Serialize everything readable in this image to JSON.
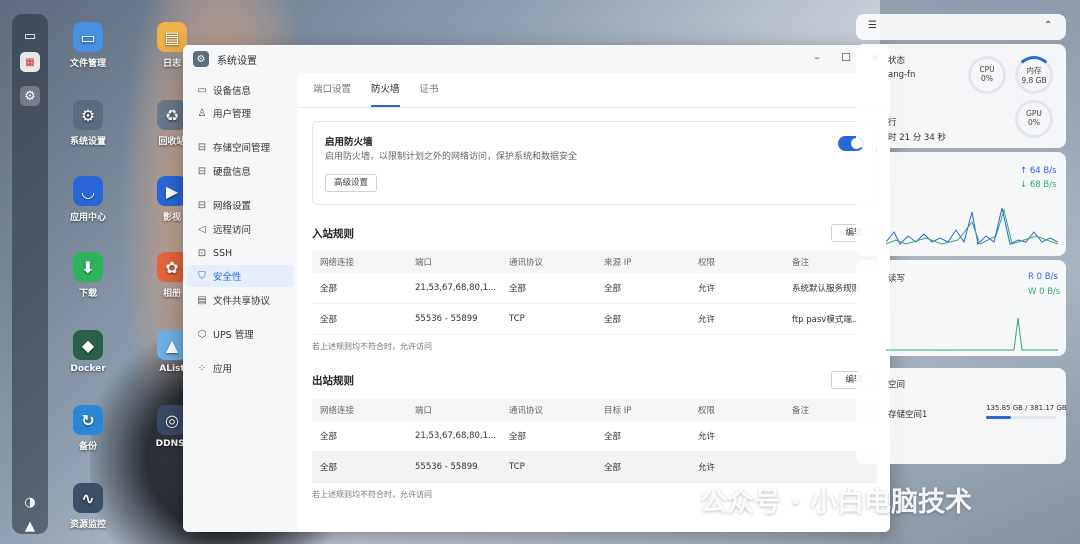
{
  "desktop": {
    "icons": [
      {
        "label": "文件管理",
        "color": "#4a90e2",
        "glyph": "▭"
      },
      {
        "label": "日志",
        "color": "#f0b04a",
        "glyph": "▤"
      },
      {
        "label": "系统设置",
        "color": "#5c6b7d",
        "glyph": "⚙"
      },
      {
        "label": "回收站",
        "color": "#6a7889",
        "glyph": "♻"
      },
      {
        "label": "应用中心",
        "color": "#2b66d9",
        "glyph": "◡"
      },
      {
        "label": "影视",
        "color": "#2b66d9",
        "glyph": "▶"
      },
      {
        "label": "下载",
        "color": "#2fb35a",
        "glyph": "⬇"
      },
      {
        "label": "相册",
        "color": "#e6653c",
        "glyph": "✿"
      },
      {
        "label": "Docker",
        "color": "#2a5f4a",
        "glyph": "◆"
      },
      {
        "label": "AList",
        "color": "#6fb2e8",
        "glyph": "▲"
      },
      {
        "label": "备份",
        "color": "#2b86d9",
        "glyph": "↻"
      },
      {
        "label": "DDNS-",
        "color": "#3a4a66",
        "glyph": "◎"
      },
      {
        "label": "资源监控",
        "color": "#3c4f66",
        "glyph": "∿"
      }
    ]
  },
  "window": {
    "title": "系统设置",
    "controls": {
      "minimize": "–",
      "maximize": "☐",
      "close": "×"
    }
  },
  "sidebar": {
    "items": [
      {
        "label": "设备信息",
        "icon": "▭"
      },
      {
        "label": "用户管理",
        "icon": "♙"
      },
      {
        "label": "存储空间管理",
        "icon": "⊟"
      },
      {
        "label": "硬盘信息",
        "icon": "⊟"
      },
      {
        "label": "网络设置",
        "icon": "⊟"
      },
      {
        "label": "远程访问",
        "icon": "◁"
      },
      {
        "label": "SSH",
        "icon": "⊡"
      },
      {
        "label": "安全性",
        "icon": "⛉"
      },
      {
        "label": "文件共享协议",
        "icon": "▤"
      },
      {
        "label": "UPS 管理",
        "icon": "⬡"
      },
      {
        "label": "应用",
        "icon": "⁘"
      }
    ],
    "active_index": 7
  },
  "tabs": [
    {
      "label": "端口设置"
    },
    {
      "label": "防火墙"
    },
    {
      "label": "证书"
    }
  ],
  "firewall": {
    "title": "启用防火墙",
    "desc": "启用防火墙，以限制计划之外的网络访问，保护系统和数据安全",
    "advanced_button": "高级设置",
    "enabled": true
  },
  "inbound": {
    "title": "入站规则",
    "edit_button": "编辑",
    "headers": [
      "网络连接",
      "端口",
      "通讯协议",
      "来源 IP",
      "权限",
      "备注"
    ],
    "rows": [
      [
        "全部",
        "21,53,67,68,80,1...",
        "全部",
        "全部",
        "允许",
        "系统默认服务规则"
      ],
      [
        "全部",
        "55536 - 55899",
        "TCP",
        "全部",
        "允许",
        "ftp pasv模式端..."
      ]
    ],
    "note": "若上述规则均不符合时，允许访问"
  },
  "outbound": {
    "title": "出站规则",
    "edit_button": "编辑",
    "headers": [
      "网络连接",
      "端口",
      "通讯协议",
      "目标 IP",
      "权限",
      "备注"
    ],
    "rows": [
      [
        "全部",
        "21,53,67,68,80,1...",
        "全部",
        "全部",
        "允许",
        ""
      ],
      [
        "全部",
        "55536 - 55899",
        "TCP",
        "全部",
        "允许",
        ""
      ]
    ],
    "note": "若上述规则均不符合时，允许访问"
  },
  "widgets": {
    "status_title": "状态",
    "hostname": "ang-fn",
    "cpu_label": "CPU",
    "cpu_value": "0%",
    "mem_label": "内存",
    "mem_value": "9.8 GB",
    "gpu_label": "GPU",
    "gpu_value": "0%",
    "uptime_label": "行",
    "uptime_value": "时 21 分 34 秒",
    "net_up": "↑ 64 B/s",
    "net_down": "↓ 68 B/s",
    "disk_title": "读写",
    "disk_read": "R 0 B/s",
    "disk_write": "W 0 B/s",
    "storage_title": "空间",
    "storage_name": "存储空间1",
    "storage_usage": "135.85 GB / 381.17 GB",
    "storage_fraction": 0.36
  },
  "watermark": "公众号 · 小白电脑技术",
  "colors": {
    "accent": "#2b66d9",
    "net_green": "#3aa76d"
  }
}
